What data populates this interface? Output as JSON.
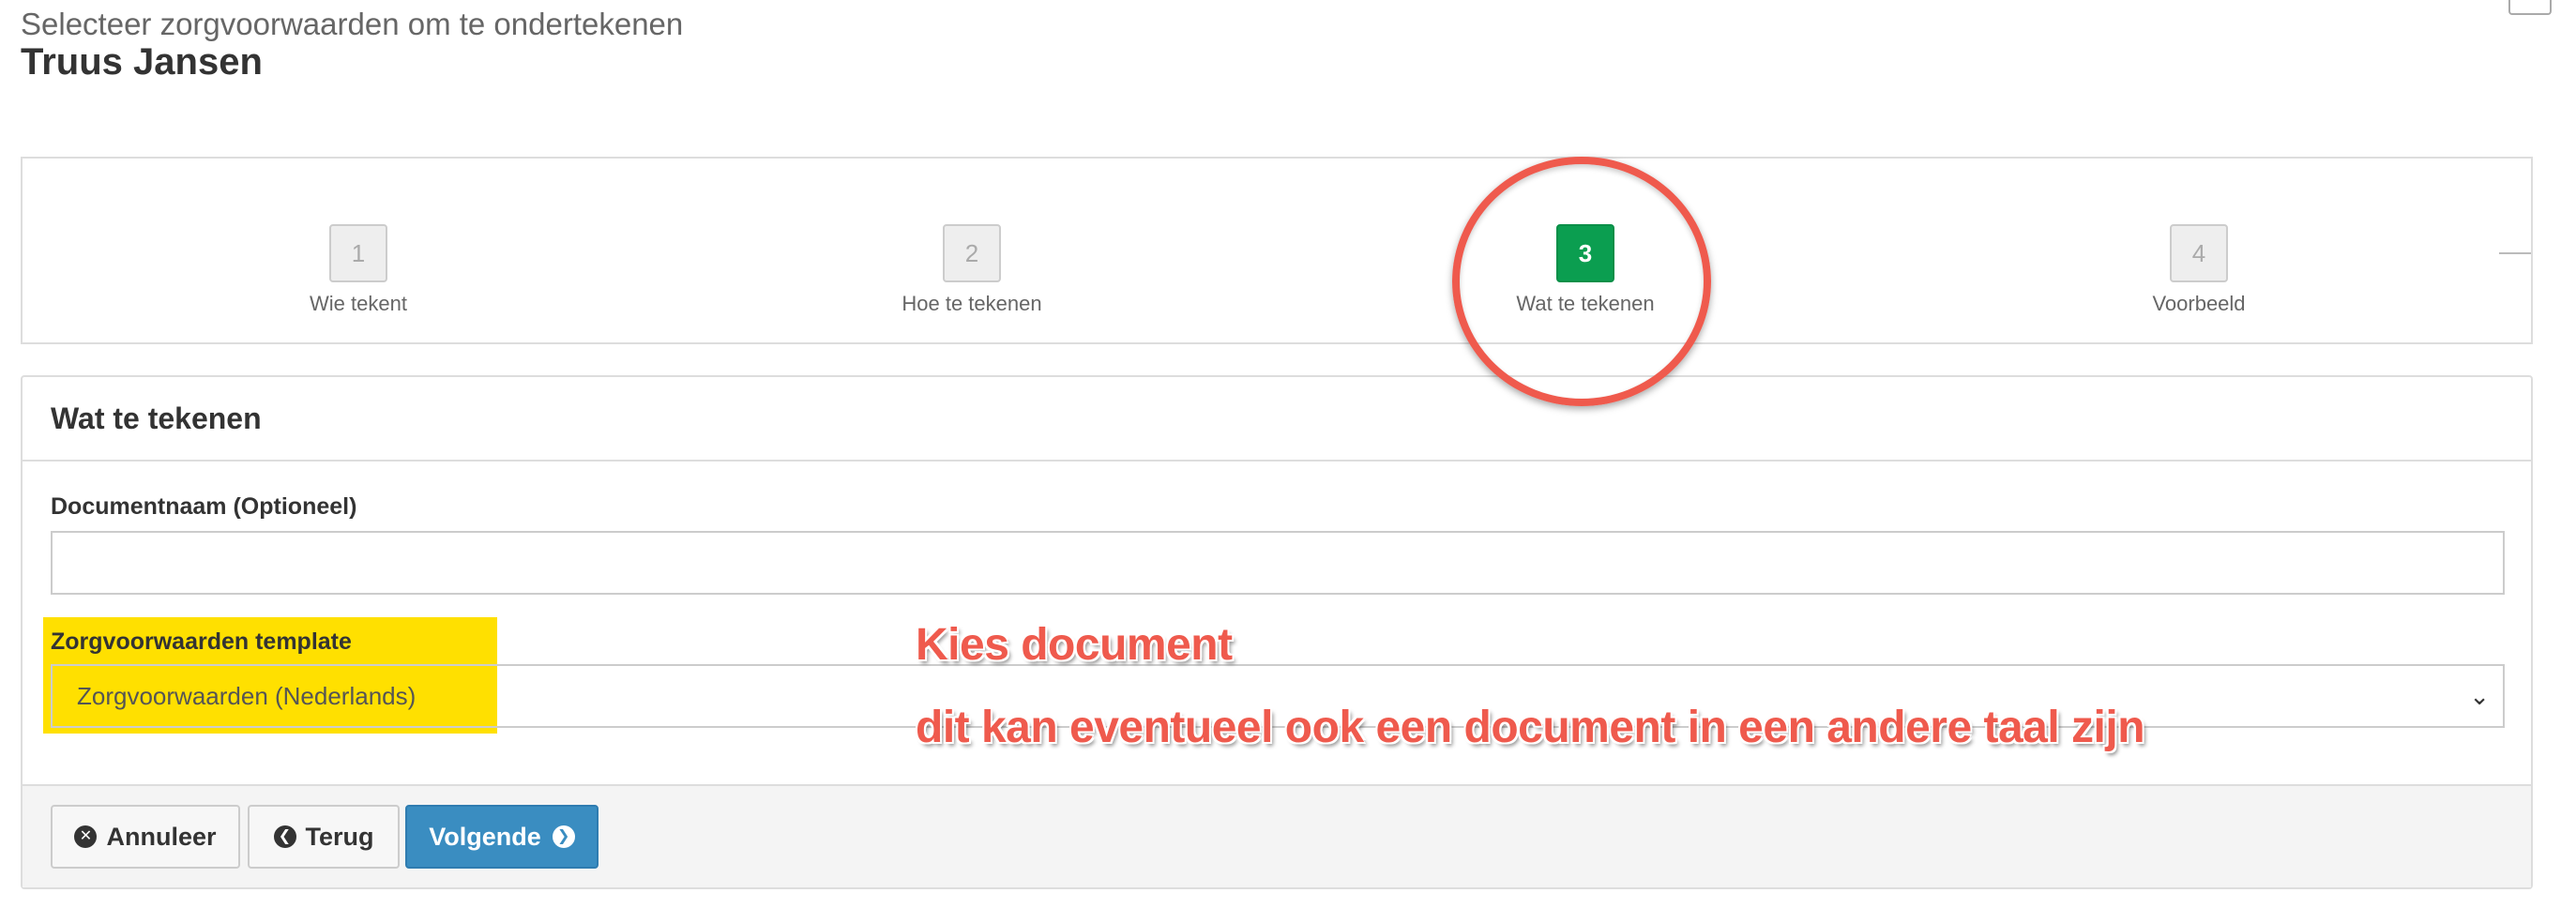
{
  "header": {
    "subtitle": "Selecteer zorgvoorwaarden om te ondertekenen",
    "name": "Truus Jansen"
  },
  "steps": [
    {
      "number": "1",
      "label": "Wie tekent",
      "active": false
    },
    {
      "number": "2",
      "label": "Hoe te tekenen",
      "active": false
    },
    {
      "number": "3",
      "label": "Wat te tekenen",
      "active": true
    },
    {
      "number": "4",
      "label": "Voorbeeld",
      "active": false
    }
  ],
  "form": {
    "heading": "Wat te tekenen",
    "document_name_label": "Documentnaam (Optioneel)",
    "document_name_value": "",
    "template_label": "Zorgvoorwaarden template",
    "template_selected": "Zorgvoorwaarden (Nederlands)"
  },
  "buttons": {
    "cancel": "Annuleer",
    "back": "Terug",
    "next": "Volgende"
  },
  "icons": {
    "cancel": "times-circle-icon",
    "back": "arrow-circle-left-icon",
    "next": "arrow-circle-right-icon",
    "select": "chevron-down-icon"
  },
  "annotations": {
    "line1": "Kies document",
    "line2": "dit kan eventueel ook een document in een andere taal zijn"
  },
  "colors": {
    "active_step": "#0b9e50",
    "primary_button": "#3a8dc1",
    "annotation": "#ef5a4d",
    "highlight": "#ffe000"
  }
}
